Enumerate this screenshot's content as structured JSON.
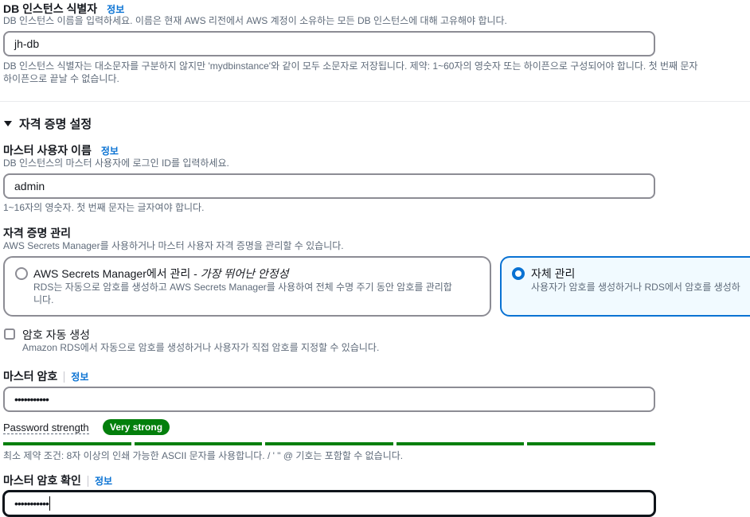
{
  "db_identifier": {
    "label": "DB 인스턴스 식별자",
    "info": "정보",
    "description": "DB 인스턴스 이름을 입력하세요. 이름은 현재 AWS 리전에서 AWS 계정이 소유하는 모든 DB 인스턴스에 대해 고유해야 합니다.",
    "value": "jh-db",
    "constraint_line1": "DB 인스턴스 식별자는 대소문자를 구분하지 않지만 'mydbinstance'와 같이 모두 소문자로 저장됩니다. 제약: 1~60자의 영숫자 또는 하이픈으로 구성되어야 합니다. 첫 번째 문자",
    "constraint_line2": "하이픈으로 끝날 수 없습니다."
  },
  "credentials": {
    "section_title": "자격 증명 설정",
    "master_username": {
      "label": "마스터 사용자 이름",
      "info": "정보",
      "description": "DB 인스턴스의 마스터 사용자에 로그인 ID를 입력하세요.",
      "value": "admin",
      "constraint": "1~16자의 영숫자. 첫 번째 문자는 글자여야 합니다."
    },
    "management": {
      "label": "자격 증명 관리",
      "description": "AWS Secrets Manager를 사용하거나 마스터 사용자 자격 증명을 관리할 수 있습니다.",
      "options": [
        {
          "title": "AWS Secrets Manager에서 관리 - ",
          "title_em": "가장 뛰어난 안정성",
          "desc_line1": "RDS는 자동으로 암호를 생성하고 AWS Secrets Manager를 사용하여 전체 수명 주기 동안 암호를 관리합",
          "desc_line2": "니다.",
          "selected": false
        },
        {
          "title": "자체 관리",
          "desc_line1": "사용자가 암호를 생성하거나 RDS에서 암호를 생성하",
          "selected": true
        }
      ]
    },
    "auto_generate": {
      "label": "암호 자동 생성",
      "description": "Amazon RDS에서 자동으로 암호를 생성하거나 사용자가 직접 암호를 지정할 수 있습니다.",
      "checked": false
    },
    "master_password": {
      "label": "마스터 암호",
      "info": "정보",
      "value": "•••••••••••",
      "strength_label": "Password strength",
      "strength_badge": "Very strong",
      "strength_segments": 5,
      "constraint": "최소 제약 조건: 8자 이상의 인쇄 가능한 ASCII 문자를 사용합니다. / ' \" @ 기호는 포함할 수 없습니다."
    },
    "confirm_password": {
      "label": "마스터 암호 확인",
      "info": "정보",
      "value": "•••••••••••"
    }
  },
  "colors": {
    "accent": "#0972d3",
    "success": "#037f0c",
    "border": "#8c8c94",
    "text_secondary": "#5f6b7a"
  }
}
